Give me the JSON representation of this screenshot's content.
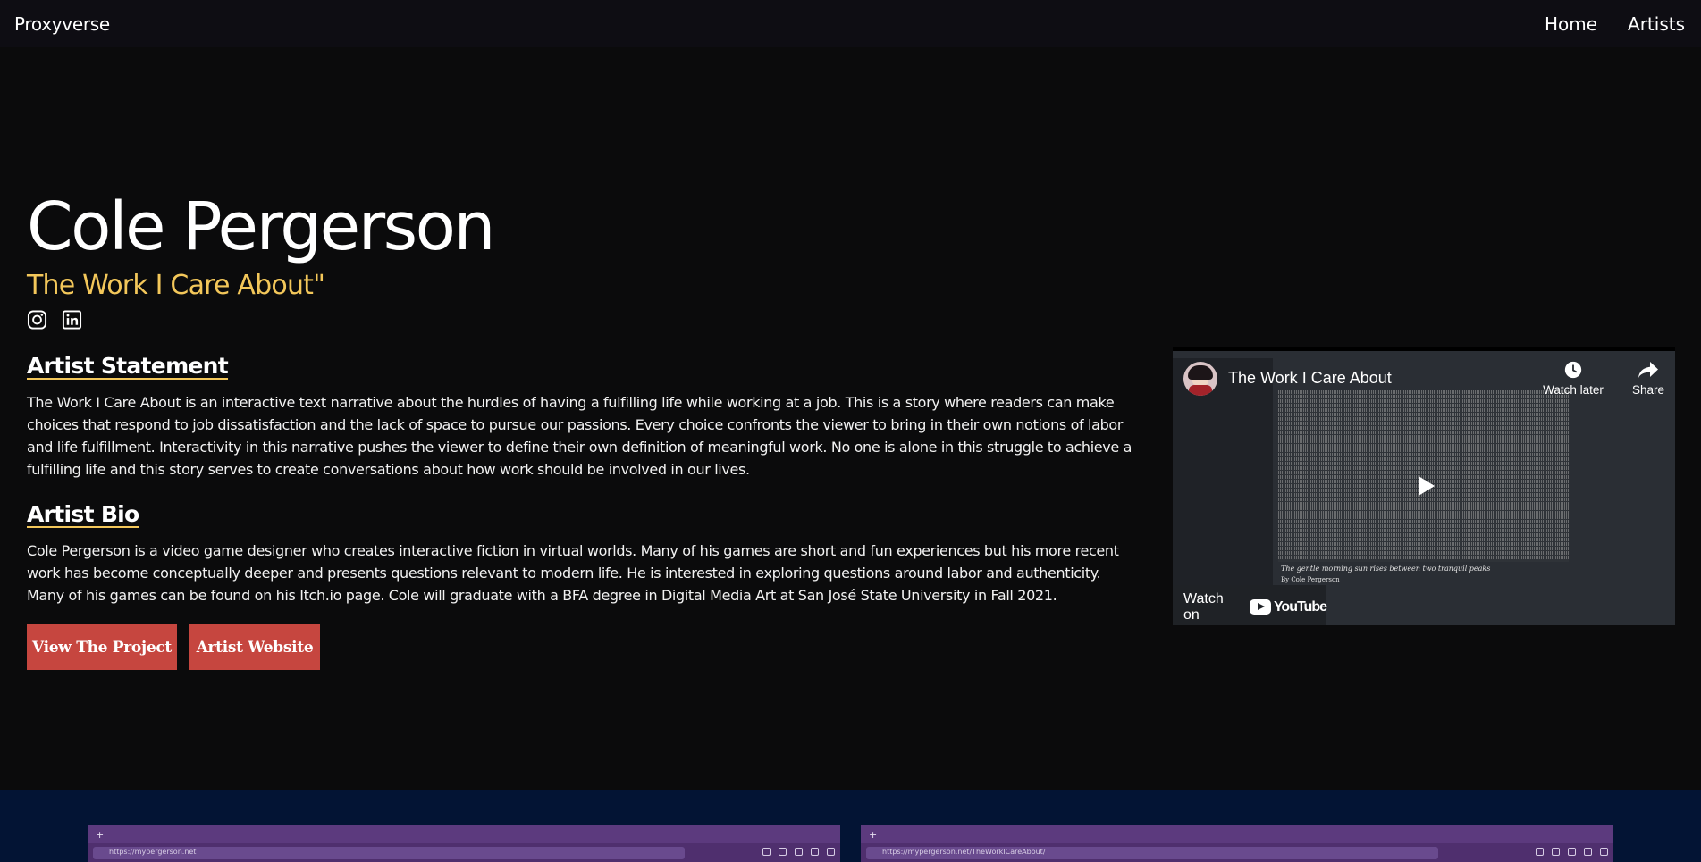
{
  "nav": {
    "brand": "Proxyverse",
    "links": [
      "Home",
      "Artists"
    ]
  },
  "hero": {
    "name": "Cole Pergerson",
    "project_title": "The Work I Care About\"",
    "socials": [
      "instagram-icon",
      "linkedin-icon"
    ],
    "statement_heading": "Artist Statement",
    "statement": "The Work I Care About is an interactive text narrative about the hurdles of having a fulfilling life while working at a job. This is a story where readers can make choices that respond to job dissatisfaction and the lack of space to pursue our passions. Every choice confronts the viewer to bring in their own notions of labor and life fulfillment. Interactivity in this narrative pushes the viewer to define their own definition of meaningful work. No one is alone in this struggle to achieve a fulfilling life and this story serves to create conversations about how work should be involved in our lives.",
    "bio_heading": "Artist Bio",
    "bio": "Cole Pergerson is a video game designer who creates interactive fiction in virtual worlds. Many of his games are short and fun experiences but his more recent work has become conceptually deeper and presents questions relevant to modern life. He is interested in exploring questions around labor and authenticity. Many of his games can be found on his Itch.io page. Cole will graduate with a BFA degree in Digital Media Art at San José State University in Fall 2021.",
    "buttons": {
      "project": "View The Project",
      "website": "Artist Website"
    }
  },
  "video": {
    "title": "The Work I Care About",
    "watch_later": "Watch later",
    "share": "Share",
    "watch_on": "Watch on",
    "youtube": "YouTube",
    "caption": "The gentle morning sun rises between two tranquil peaks",
    "caption_author": "By Cole Pergerson"
  },
  "screenshots": [
    {
      "url": "https://mypergerson.net"
    },
    {
      "url": "https://mypergerson.net/TheWorkICareAbout/"
    }
  ],
  "colors": {
    "accent": "#f3c75a",
    "button": "#c6463f",
    "background": "#0b0b0c",
    "bottom_section": "#031434"
  }
}
